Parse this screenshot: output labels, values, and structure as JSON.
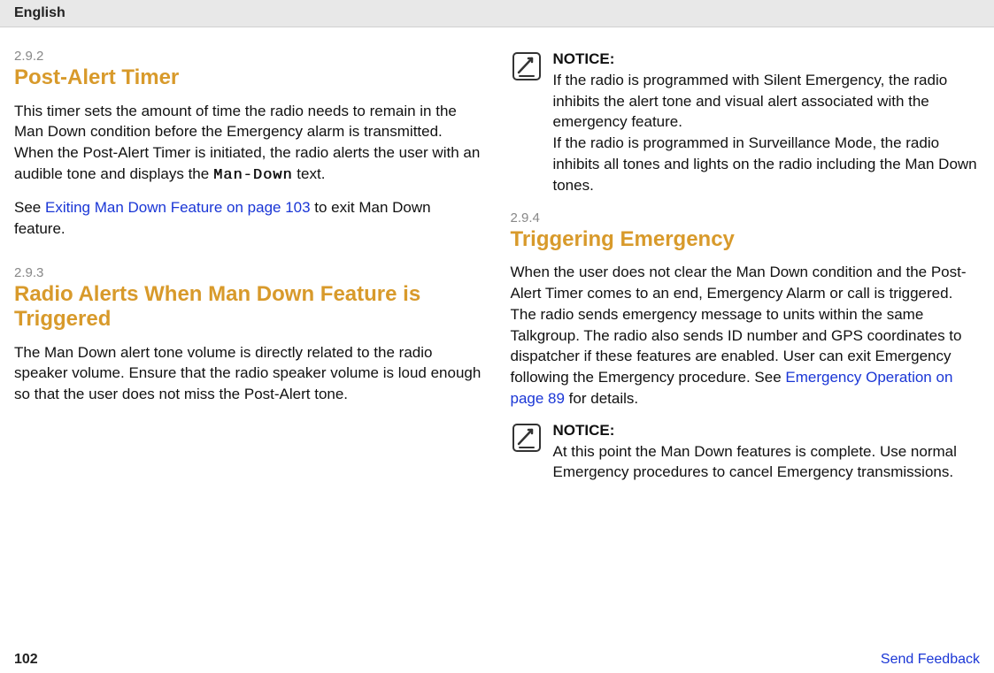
{
  "header": {
    "lang": "English"
  },
  "left": {
    "sec1": {
      "num": "2.9.2",
      "title": "Post-Alert Timer",
      "para1_a": "This timer sets the amount of time the radio needs to remain in the Man Down condition before the Emergency alarm is transmitted. When the Post-Alert Timer is initiated, the radio alerts the user with an audible tone and displays the ",
      "mono": "Man-Down",
      "para1_b": " text.",
      "para2_a": "See ",
      "link": "Exiting Man Down Feature on page 103",
      "para2_b": " to exit Man Down feature."
    },
    "sec2": {
      "num": "2.9.3",
      "title": "Radio Alerts When Man Down Feature is Triggered",
      "para": "The Man Down alert tone volume is directly related to the radio speaker volume. Ensure that the radio speaker volume is loud enough so that the user does not miss the Post-Alert tone."
    }
  },
  "right": {
    "notice1": {
      "label": "NOTICE:",
      "p1": "If the radio is programmed with Silent Emergency, the radio inhibits the alert tone and visual alert associated with the emergency feature.",
      "p2": "If the radio is programmed in Surveillance Mode, the radio inhibits all tones and lights on the radio including the Man Down tones."
    },
    "sec3": {
      "num": "2.9.4",
      "title": "Triggering Emergency",
      "para_a": "When the user does not clear the Man Down condition and the Post-Alert Timer comes to an end, Emergency Alarm or call is triggered. The radio sends emergency message to units within the same Talkgroup. The radio also sends ID number and GPS coordinates to dispatcher if these features are enabled. User can exit Emergency following the Emergency procedure. See ",
      "link": "Emergency Operation on page 89",
      "para_b": " for details."
    },
    "notice2": {
      "label": "NOTICE:",
      "p1": "At this point the Man Down features is complete. Use normal Emergency procedures to cancel Emergency transmissions."
    }
  },
  "footer": {
    "page": "102",
    "feedback": "Send Feedback"
  }
}
